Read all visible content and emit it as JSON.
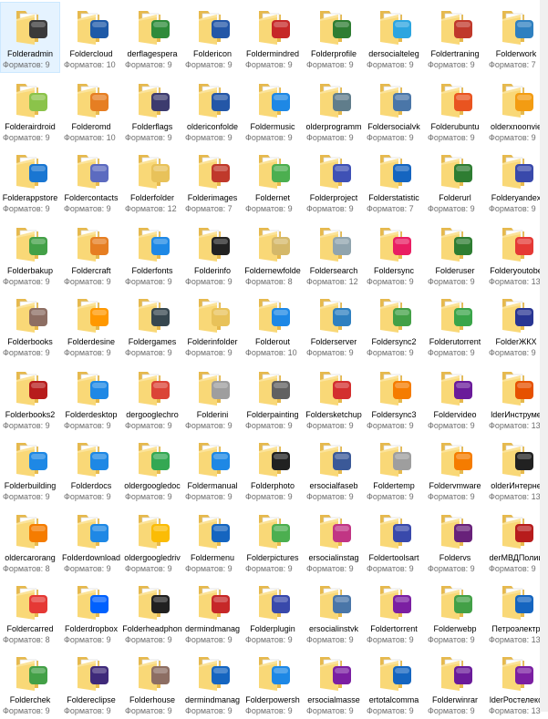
{
  "folders": [
    {
      "name": "Folderadmin",
      "formats": "Форматов: 9",
      "icon": "user-icon",
      "color": "#3a3a3a",
      "selected": true
    },
    {
      "name": "Foldercloud",
      "formats": "Форматов: 10",
      "icon": "cloud-icon",
      "color": "#1e5aa8"
    },
    {
      "name": "derflagespera",
      "formats": "Форматов: 9",
      "icon": "flag-icon",
      "color": "#2e8b3a"
    },
    {
      "name": "Foldericon",
      "formats": "Форматов: 9",
      "icon": "letter-i-icon",
      "color": "#2457a7"
    },
    {
      "name": "Foldermindred",
      "formats": "Форматов: 9",
      "icon": "brain-icon",
      "color": "#c62828"
    },
    {
      "name": "Folderprofile",
      "formats": "Форматов: 9",
      "icon": "person-icon",
      "color": "#2e7d32"
    },
    {
      "name": "dersocialteleg",
      "formats": "Форматов: 9",
      "icon": "telegram-icon",
      "color": "#2ca5e0"
    },
    {
      "name": "Foldertraning",
      "formats": "Форматов: 9",
      "icon": "building-icon",
      "color": "#c0392b"
    },
    {
      "name": "Folderwork",
      "formats": "Форматов: 7",
      "icon": "server-icon",
      "color": "#2f80c0"
    },
    {
      "name": "Folderairdroid",
      "formats": "Форматов: 9",
      "icon": "plane-icon",
      "color": "#8bc34a"
    },
    {
      "name": "Folderomd",
      "formats": "Форматов: 10",
      "icon": "window-icon",
      "color": "#e67e22"
    },
    {
      "name": "Folderflags",
      "formats": "Форматов: 9",
      "icon": "us-flag-icon",
      "color": "#3c3b6e"
    },
    {
      "name": "oldericonfolde",
      "formats": "Форматов: 9",
      "icon": "letter-i-icon",
      "color": "#2457a7"
    },
    {
      "name": "Foldermusic",
      "formats": "Форматов: 9",
      "icon": "music-note-icon",
      "color": "#1e88e5"
    },
    {
      "name": "olderprogramm",
      "formats": "Форматов: 9",
      "icon": "gears-icon",
      "color": "#607d8b"
    },
    {
      "name": "Foldersocialvk",
      "formats": "Форматов: 9",
      "icon": "vk-icon",
      "color": "#4a76a8"
    },
    {
      "name": "Folderubuntu",
      "formats": "Форматов: 9",
      "icon": "ubuntu-icon",
      "color": "#e95420"
    },
    {
      "name": "olderxnoonvie",
      "formats": "Форматов: 9",
      "icon": "gear-icon",
      "color": "#f39c12"
    },
    {
      "name": "Folderappstore",
      "formats": "Форматов: 9",
      "icon": "appstore-icon",
      "color": "#1976d2"
    },
    {
      "name": "Foldercontacts",
      "formats": "Форматов: 9",
      "icon": "contacts-icon",
      "color": "#5c6bc0"
    },
    {
      "name": "Folderfolder",
      "formats": "Форматов: 12",
      "icon": "folder-icon",
      "color": "#e8c25a"
    },
    {
      "name": "Folderimages",
      "formats": "Форматов: 7",
      "icon": "image-icon",
      "color": "#c0392b"
    },
    {
      "name": "Foldernet",
      "formats": "Форматов: 9",
      "icon": "network-icon",
      "color": "#4caf50"
    },
    {
      "name": "Folderproject",
      "formats": "Форматов: 9",
      "icon": "blueprint-icon",
      "color": "#3f51b5"
    },
    {
      "name": "Folderstatistic",
      "formats": "Форматов: 7",
      "icon": "pie-chart-icon",
      "color": "#1565c0"
    },
    {
      "name": "Folderurl",
      "formats": "Форматов: 9",
      "icon": "globe-icon",
      "color": "#2e7d32"
    },
    {
      "name": "Folderyandex",
      "formats": "Форматов: 9",
      "icon": "ufo-icon",
      "color": "#3949ab"
    },
    {
      "name": "Folderbakup",
      "formats": "Форматов: 9",
      "icon": "clock-backup-icon",
      "color": "#43a047"
    },
    {
      "name": "Foldercraft",
      "formats": "Форматов: 9",
      "icon": "craft-icon",
      "color": "#e67e22"
    },
    {
      "name": "Folderfonts",
      "formats": "Форматов: 9",
      "icon": "font-icon",
      "color": "#1e88e5"
    },
    {
      "name": "Folderinfo",
      "formats": "Форматов: 9",
      "icon": "info-icon",
      "color": "#222222"
    },
    {
      "name": "Foldernewfolde",
      "formats": "Форматов: 8",
      "icon": "folder-icon",
      "color": "#d4b86a"
    },
    {
      "name": "Foldersearch",
      "formats": "Форматов: 12",
      "icon": "magnifier-icon",
      "color": "#90a4ae"
    },
    {
      "name": "Foldersync",
      "formats": "Форматов: 9",
      "icon": "sync-icon",
      "color": "#e91e63"
    },
    {
      "name": "Folderuser",
      "formats": "Форматов: 9",
      "icon": "person-icon",
      "color": "#2e7d32"
    },
    {
      "name": "Folderyoutobe",
      "formats": "Форматов: 13",
      "icon": "youtube-icon",
      "color": "#e53935"
    },
    {
      "name": "Folderbooks",
      "formats": "Форматов: 9",
      "icon": "books-icon",
      "color": "#8d6e63"
    },
    {
      "name": "Folderdesine",
      "formats": "Форматов: 9",
      "icon": "design-icon",
      "color": "#ff9800"
    },
    {
      "name": "Foldergames",
      "formats": "Форматов: 9",
      "icon": "chess-icon",
      "color": "#37474f"
    },
    {
      "name": "Folderinfolder",
      "formats": "Форматов: 9",
      "icon": "folder-icon",
      "color": "#e8c25a"
    },
    {
      "name": "Folderout",
      "formats": "Форматов: 10",
      "icon": "arrow-out-icon",
      "color": "#1e88e5"
    },
    {
      "name": "Folderserver",
      "formats": "Форматов: 9",
      "icon": "server-icon",
      "color": "#2f80c0"
    },
    {
      "name": "Foldersync2",
      "formats": "Форматов: 9",
      "icon": "sync-icon",
      "color": "#43a047"
    },
    {
      "name": "Folderutorrent",
      "formats": "Форматов: 9",
      "icon": "utorrent-icon",
      "color": "#3aa54a"
    },
    {
      "name": "FolderЖКХ",
      "formats": "Форматов: 9",
      "icon": "housing-icon",
      "color": "#283593"
    },
    {
      "name": "Folderbooks2",
      "formats": "Форматов: 9",
      "icon": "books-icon",
      "color": "#b71c1c"
    },
    {
      "name": "Folderdesktop",
      "formats": "Форматов: 9",
      "icon": "monitor-icon",
      "color": "#1e88e5"
    },
    {
      "name": "dergooglechro",
      "formats": "Форматов: 9",
      "icon": "chrome-icon",
      "color": "#db4437"
    },
    {
      "name": "Folderini",
      "formats": "Форматов: 9",
      "icon": "gear-icon",
      "color": "#9e9e9e"
    },
    {
      "name": "Folderpainting",
      "formats": "Форматов: 9",
      "icon": "painting-icon",
      "color": "#616161"
    },
    {
      "name": "Foldersketchup",
      "formats": "Форматов: 9",
      "icon": "sketchup-icon",
      "color": "#d32f2f"
    },
    {
      "name": "Foldersync3",
      "formats": "Форматов: 9",
      "icon": "sync-icon",
      "color": "#f57c00"
    },
    {
      "name": "Foldervideo",
      "formats": "Форматов: 9",
      "icon": "film-icon",
      "color": "#6a1b9a"
    },
    {
      "name": "lderИнструме",
      "formats": "Форматов: 13",
      "icon": "tools-icon",
      "color": "#e65100"
    },
    {
      "name": "Folderbuilding",
      "formats": "Форматов: 9",
      "icon": "building-icon",
      "color": "#1e88e5"
    },
    {
      "name": "Folderdocs",
      "formats": "Форматов: 9",
      "icon": "document-icon",
      "color": "#1e88e5"
    },
    {
      "name": "oldergoogledoc",
      "formats": "Форматов: 9",
      "icon": "google-docs-icon",
      "color": "#34a853"
    },
    {
      "name": "Foldermanual",
      "formats": "Форматов: 9",
      "icon": "manual-icon",
      "color": "#1e88e5"
    },
    {
      "name": "Folderphoto",
      "formats": "Форматов: 9",
      "icon": "camera-icon",
      "color": "#212121"
    },
    {
      "name": "ersocialfaseb",
      "formats": "Форматов: 9",
      "icon": "facebook-icon",
      "color": "#3b5998"
    },
    {
      "name": "Foldertemp",
      "formats": "Форматов: 9",
      "icon": "clock-icon",
      "color": "#9e9e9e"
    },
    {
      "name": "Foldervmware",
      "formats": "Форматов: 9",
      "icon": "vmware-icon",
      "color": "#f57c00"
    },
    {
      "name": "olderИнтерне",
      "formats": "Форматов: 13",
      "icon": "internet-icon",
      "color": "#212121"
    },
    {
      "name": "oldercarorang",
      "formats": "Форматов: 8",
      "icon": "car-icon",
      "color": "#f57c00"
    },
    {
      "name": "Folderdownload",
      "formats": "Форматов: 9",
      "icon": "download-icon",
      "color": "#1e88e5"
    },
    {
      "name": "oldergoogledriv",
      "formats": "Форматов: 9",
      "icon": "google-drive-icon",
      "color": "#fbbc05"
    },
    {
      "name": "Foldermenu",
      "formats": "Форматов: 9",
      "icon": "menu-icon",
      "color": "#1565c0"
    },
    {
      "name": "Folderpictures",
      "formats": "Форматов: 9",
      "icon": "picture-icon",
      "color": "#4caf50"
    },
    {
      "name": "ersocialinstag",
      "formats": "Форматов: 9",
      "icon": "instagram-icon",
      "color": "#c13584"
    },
    {
      "name": "Foldertoolsart",
      "formats": "Форматов: 9",
      "icon": "art-tools-icon",
      "color": "#3949ab"
    },
    {
      "name": "Foldervs",
      "formats": "Форматов: 9",
      "icon": "visual-studio-icon",
      "color": "#68217a"
    },
    {
      "name": "derМВДПолиц",
      "formats": "Форматов: 9",
      "icon": "police-badge-icon",
      "color": "#b71c1c"
    },
    {
      "name": "Foldercarred",
      "formats": "Форматов: 8",
      "icon": "car-icon",
      "color": "#e53935"
    },
    {
      "name": "Folderdropbox",
      "formats": "Форматов: 9",
      "icon": "dropbox-icon",
      "color": "#0061fe"
    },
    {
      "name": "Folderheadphon",
      "formats": "Форматов: 9",
      "icon": "headphones-icon",
      "color": "#212121"
    },
    {
      "name": "dermindmanag",
      "formats": "Форматов: 9",
      "icon": "mindmanager-icon",
      "color": "#c62828"
    },
    {
      "name": "Folderplugin",
      "formats": "Форматов: 9",
      "icon": "puzzle-icon",
      "color": "#3949ab"
    },
    {
      "name": "ersocialinstvk",
      "formats": "Форматов: 9",
      "icon": "vk-icon",
      "color": "#4a76a8"
    },
    {
      "name": "Foldertorrent",
      "formats": "Форматов: 9",
      "icon": "bittorrent-icon",
      "color": "#7b1fa2"
    },
    {
      "name": "Folderwebp",
      "formats": "Форматов: 9",
      "icon": "webp-icon",
      "color": "#43a047"
    },
    {
      "name": "Петроэлектр",
      "formats": "Форматов: 13",
      "icon": "energy-logo-icon",
      "color": "#1565c0"
    },
    {
      "name": "Folderchek",
      "formats": "Форматов: 9",
      "icon": "checkmark-icon",
      "color": "#43a047"
    },
    {
      "name": "Foldereclipse",
      "formats": "Форматов: 9",
      "icon": "eclipse-icon",
      "color": "#3f2a7a"
    },
    {
      "name": "Folderhouse",
      "formats": "Форматов: 9",
      "icon": "house-icon",
      "color": "#8d6e63"
    },
    {
      "name": "dermindmanag",
      "formats": "Форматов: 9",
      "icon": "mindmanager-icon",
      "color": "#1565c0"
    },
    {
      "name": "Folderpowersh",
      "formats": "Форматов: 9",
      "icon": "powershell-icon",
      "color": "#1e88e5"
    },
    {
      "name": "ersocialmasse",
      "formats": "Форматов: 9",
      "icon": "messengers-icon",
      "color": "#7b1fa2"
    },
    {
      "name": "ertotalcomma",
      "formats": "Форматов: 9",
      "icon": "floppy-disk-icon",
      "color": "#1565c0"
    },
    {
      "name": "Folderwinrar",
      "formats": "Форматов: 9",
      "icon": "winrar-icon",
      "color": "#6a1b9a"
    },
    {
      "name": "lderРостелеко",
      "formats": "Форматов: 13",
      "icon": "rostelecom-icon",
      "color": "#7b1fa2"
    }
  ]
}
